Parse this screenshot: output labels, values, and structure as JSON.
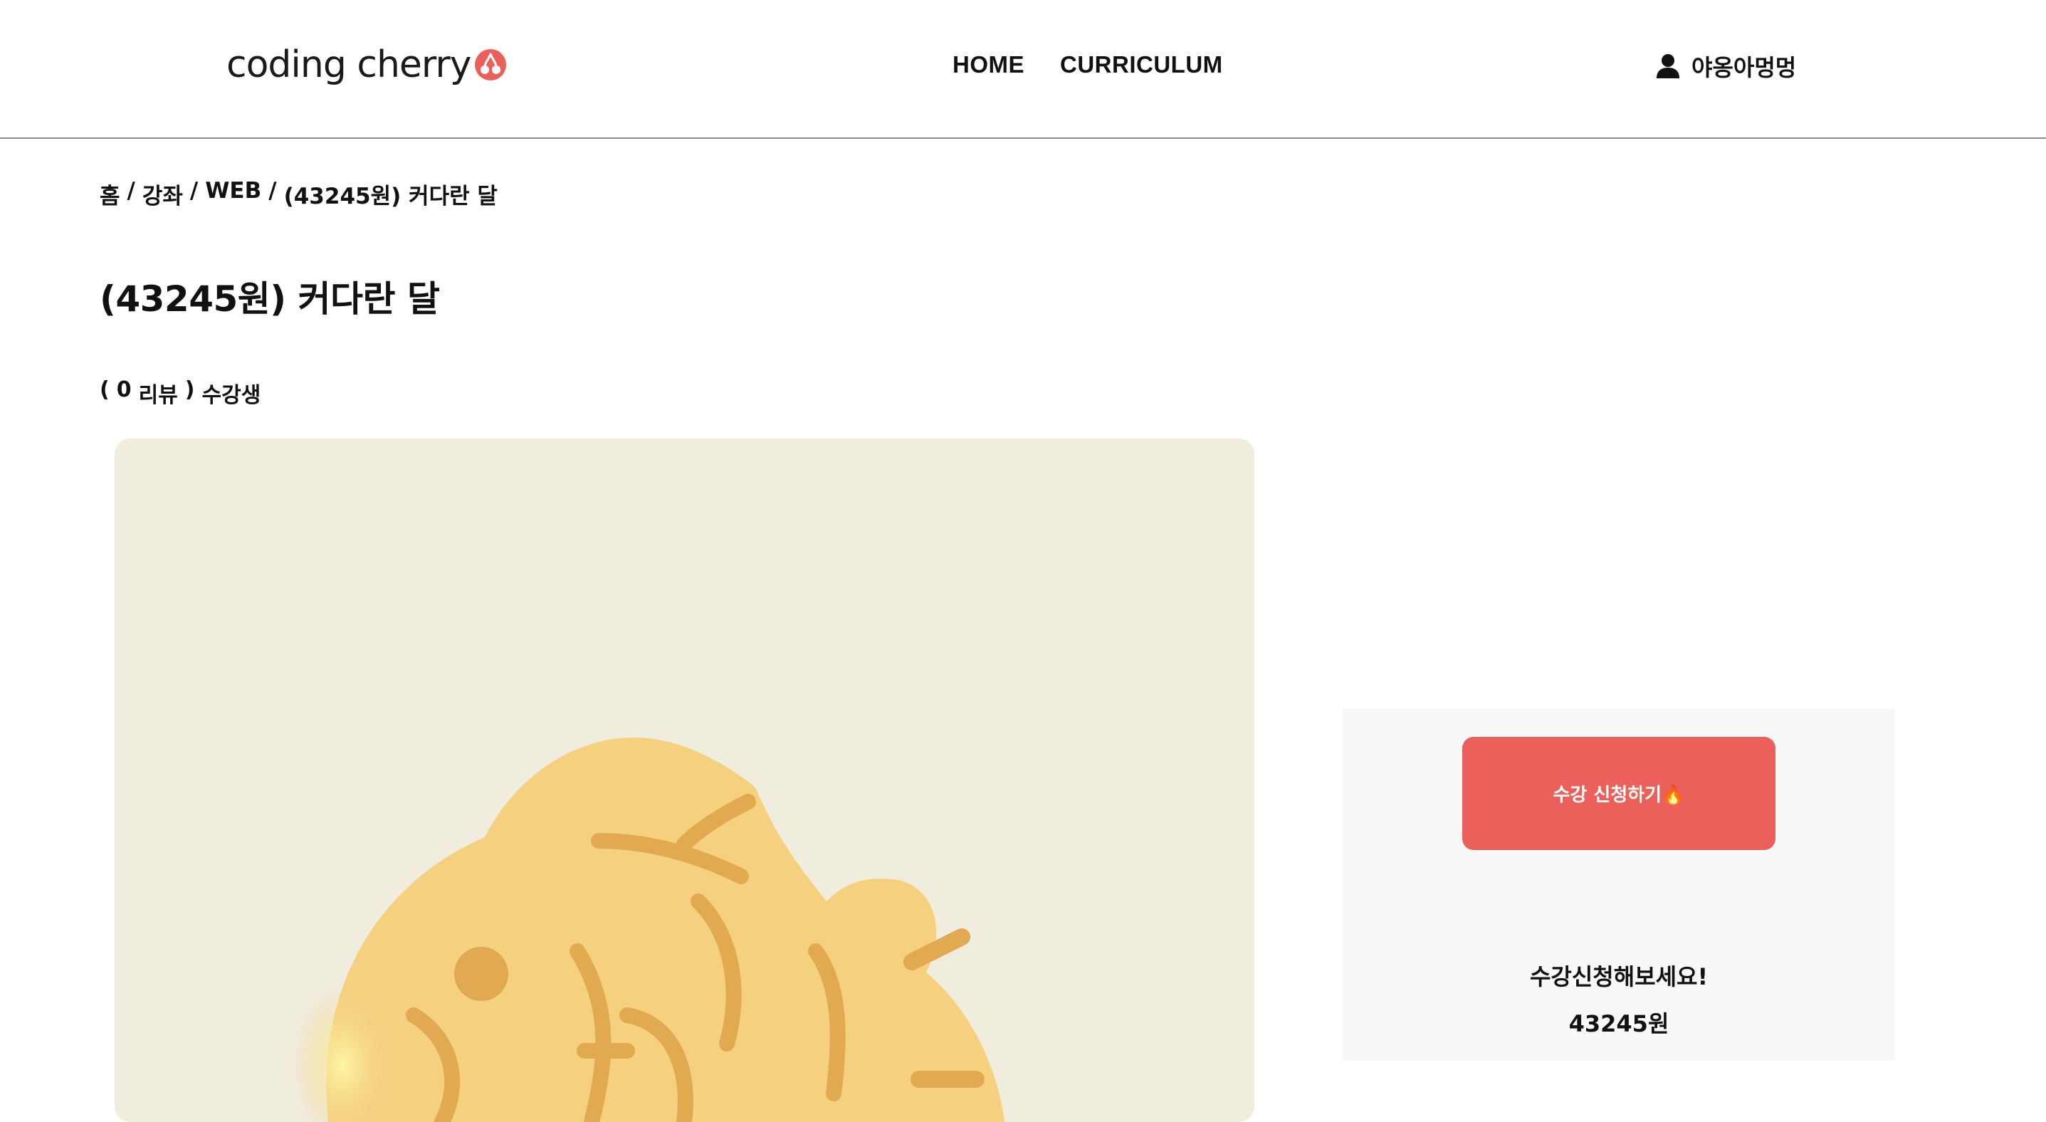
{
  "header": {
    "logo_text": "coding cherry",
    "nav": [
      {
        "label": "HOME"
      },
      {
        "label": "CURRICULUM"
      }
    ],
    "user_name": "야옹아멍멍"
  },
  "breadcrumb": [
    "홈",
    "강좌",
    "WEB",
    "(43245원) 커다란 달"
  ],
  "breadcrumb_separator": "/",
  "course": {
    "title": "(43245원) 커다란 달",
    "reviews_open": "(",
    "review_count": "0",
    "reviews_label": "리뷰",
    "reviews_close": ")",
    "students_label": "수강생"
  },
  "enroll_card": {
    "button_label": "수강 신청하기🔥",
    "message": "수강신청해보세요!",
    "price": "43245원"
  },
  "colors": {
    "accent": "#ec605b",
    "thumbnail_bg": "#f0ecde",
    "taiyaki": "#f4d07f",
    "taiyaki_line": "#e2aa50"
  }
}
